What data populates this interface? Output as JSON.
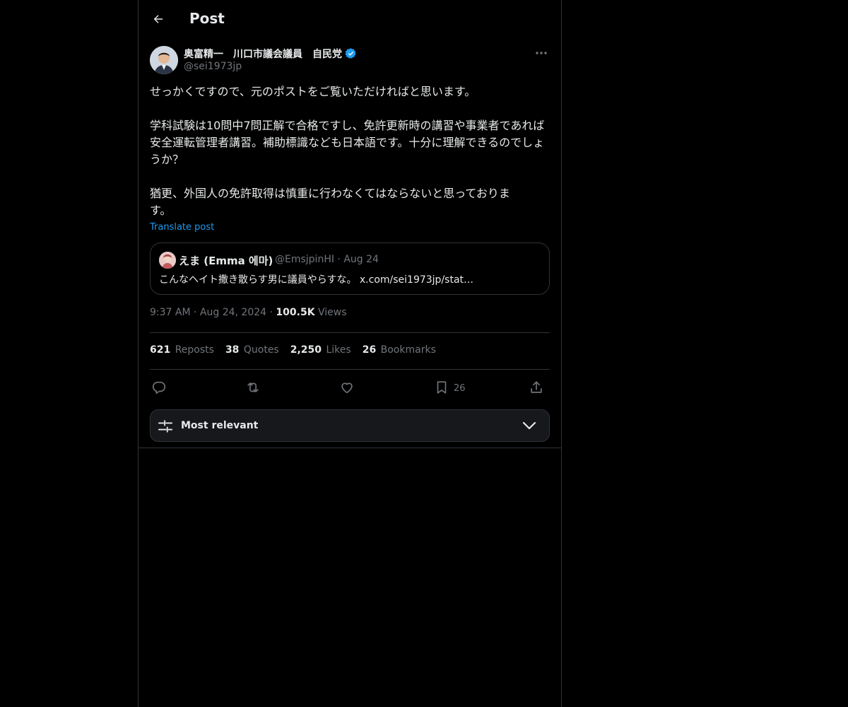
{
  "header": {
    "title": "Post"
  },
  "author": {
    "name": "奥富精一　川口市議会議員　自民党",
    "handle": "@sei1973jp"
  },
  "post": {
    "text": "せっかくですので、元のポストをご覧いただければと思います。\n\n学科試験は10問中7問正解で合格ですし、免許更新時の講習や事業者であれば安全運転管理者講習。補助標識なども日本語です。十分に理解できるのでしょうか？\n\n猶更、外国人の免許取得は慎重に行わなくてはならないと思っておりま\nす。",
    "translate_label": "Translate post"
  },
  "quote": {
    "name": "えま (Emma 에마)",
    "handle_date": "@EmsjpinHI · Aug 24",
    "text": "こんなヘイト撒き散らす男に議員やらすな。 x.com/sei1973jp/stat…"
  },
  "meta": {
    "time": "9:37 AM",
    "sep1": " · ",
    "date": "Aug 24, 2024",
    "sep2": " · ",
    "views_count": "100.5K",
    "views_label": " Views"
  },
  "stats": {
    "reposts_count": "621",
    "reposts_label": "Reposts",
    "quotes_count": "38",
    "quotes_label": "Quotes",
    "likes_count": "2,250",
    "likes_label": "Likes",
    "bookmarks_count": "26",
    "bookmarks_label": "Bookmarks"
  },
  "actions": {
    "bookmark_count": "26"
  },
  "sort": {
    "label": "Most relevant"
  },
  "icons": {
    "back": "arrow-left-icon",
    "more": "more-horizontal-icon",
    "verified": "verified-badge-icon",
    "reply": "reply-icon",
    "repost": "repost-icon",
    "like": "heart-icon",
    "bookmark": "bookmark-icon",
    "share": "share-icon",
    "sort": "sliders-icon",
    "chevron": "chevron-down-icon"
  },
  "colors": {
    "accent": "#1d9bf0",
    "background": "#000000",
    "muted": "#71767b",
    "border": "#2f3336"
  }
}
